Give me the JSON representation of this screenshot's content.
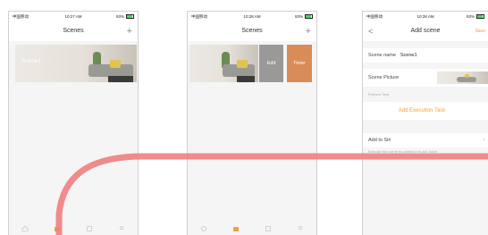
{
  "status_bar": {
    "carrier": "中国移动",
    "battery": "93%",
    "times": [
      "10:27 AM",
      "10:28 AM",
      "10:28 AM"
    ]
  },
  "screen1": {
    "title": "Scenes",
    "plus_icon": "+",
    "scene_name": "Scene1"
  },
  "screen2": {
    "title": "Scenes",
    "plus_icon": "+",
    "edit_label": "Edit",
    "timer_label": "Timer"
  },
  "screen3": {
    "title": "Add scene",
    "back_icon": "<",
    "save_label": "Save",
    "scene_name_label": "Scene name",
    "scene_name_value": "Scene1",
    "scene_picture_label": "Scene Picture",
    "perform_task_label": "Perform Task",
    "add_task_label": "Add Execution Task",
    "add_to_siri_label": "Add to Siri",
    "siri_description": "Execute the scene by adding it to ask Voice"
  },
  "tabbar_icons": [
    "home-icon",
    "scenes-icon",
    "devices-icon",
    "profile-icon"
  ],
  "colors": {
    "accent": "#f0a040",
    "edit_button": "#9a9998",
    "timer_button": "#d98b58",
    "gesture_line": "#f08080"
  }
}
